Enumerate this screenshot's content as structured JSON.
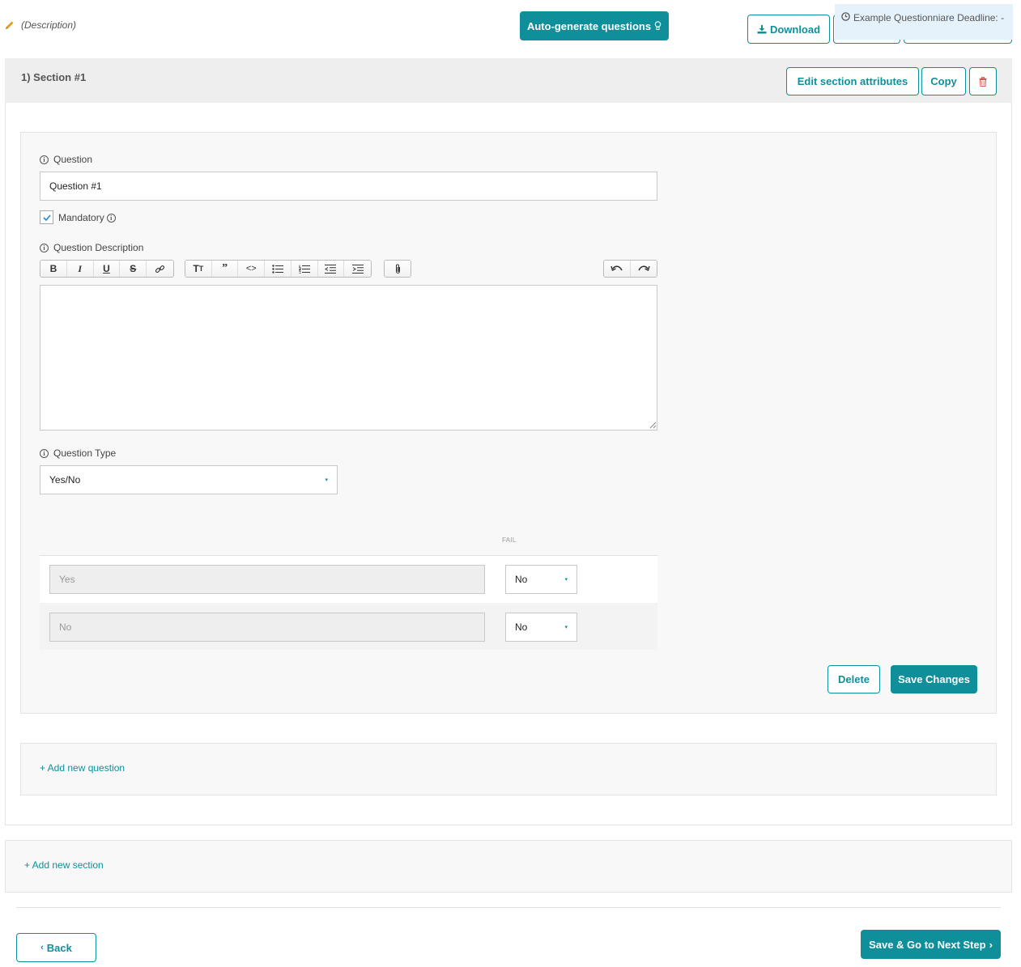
{
  "header": {
    "description": "(Description)",
    "auto_generate_label": "Auto-generate questions",
    "download_label": "Download",
    "deadline_text": "Example Questionniare Deadline: -"
  },
  "section": {
    "title": "1) Section #1",
    "edit_label": "Edit section attributes",
    "copy_label": "Copy"
  },
  "question": {
    "question_label": "Question",
    "question_value": "Question #1",
    "mandatory_label": "Mandatory",
    "mandatory_checked": true,
    "description_label": "Question Description",
    "description_value": "",
    "type_label": "Question Type",
    "type_value": "Yes/No",
    "fail_header": "FAIL",
    "options": [
      {
        "placeholder": "Yes",
        "fail": "No"
      },
      {
        "placeholder": "No",
        "fail": "No"
      }
    ],
    "delete_label": "Delete",
    "save_label": "Save Changes"
  },
  "add_question_label": "+ Add new question",
  "add_section_label": "+ Add new section",
  "footer": {
    "back_label": "Back",
    "next_label": "Save & Go to Next Step"
  },
  "colors": {
    "accent": "#0e8f9a",
    "danger": "#d9534f",
    "pencil": "#e0a020"
  }
}
